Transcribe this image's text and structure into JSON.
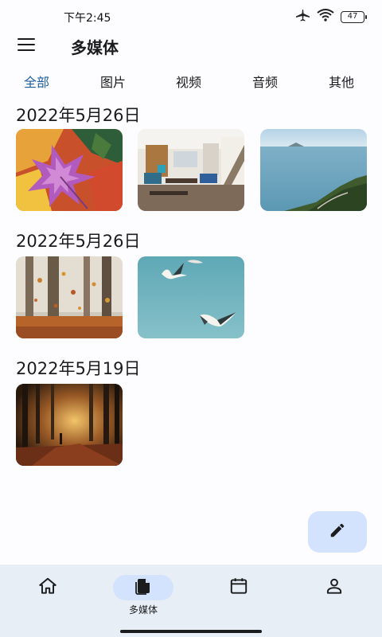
{
  "status_bar": {
    "time": "下午2:45",
    "battery": "47",
    "icons": [
      "airplane-icon",
      "wifi-icon",
      "battery-icon"
    ]
  },
  "app_bar": {
    "title": "多媒体",
    "menu_icon": "menu-icon"
  },
  "tabs": [
    {
      "label": "全部",
      "active": true
    },
    {
      "label": "图片",
      "active": false
    },
    {
      "label": "视频",
      "active": false
    },
    {
      "label": "音频",
      "active": false
    },
    {
      "label": "其他",
      "active": false
    }
  ],
  "groups": [
    {
      "date": "2022年5月26日",
      "items": [
        "autumn-leaves-photo",
        "living-room-photo",
        "seaside-coast-photo"
      ]
    },
    {
      "date": "2022年5月26日",
      "items": [
        "autumn-forest-photo",
        "seagulls-sky-photo"
      ]
    },
    {
      "date": "2022年5月19日",
      "items": [
        "sunset-forest-photo"
      ]
    }
  ],
  "fab": {
    "icon": "edit-pencil-icon"
  },
  "bottom_nav": [
    {
      "icon": "home-icon",
      "label": "",
      "active": false
    },
    {
      "icon": "media-files-icon",
      "label": "多媒体",
      "active": true
    },
    {
      "icon": "calendar-icon",
      "label": "",
      "active": false
    },
    {
      "icon": "profile-icon",
      "label": "",
      "active": false
    }
  ],
  "colors": {
    "accent": "#1d5fa0",
    "background": "#fdfcff",
    "nav_background": "#e8eef5",
    "pill": "#d3e3fd"
  }
}
